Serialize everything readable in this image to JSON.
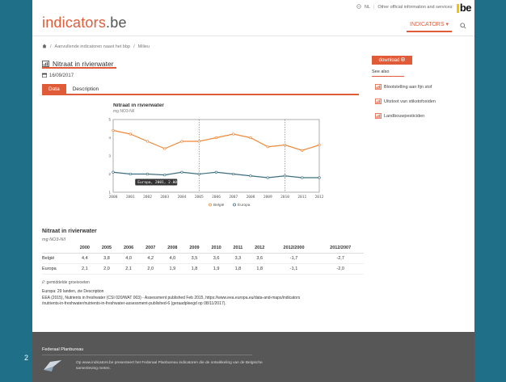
{
  "slide": {
    "number": "2"
  },
  "topbar": {
    "lang": "NL",
    "other_link": "Other official information and services:",
    "logo": "be"
  },
  "brand": {
    "name": "indicators",
    "suffix": ".be"
  },
  "nav": {
    "indicators_label": "INDICATORS",
    "search_icon": "search-icon"
  },
  "breadcrumb": {
    "home_icon": "home-icon",
    "items": [
      "Aanvullende indicatoren naast het bbp",
      "Milieu"
    ]
  },
  "page": {
    "title": "Nitraat in rivierwater",
    "date": "16/09/2017"
  },
  "tabs": [
    {
      "label": "Data",
      "active": true
    },
    {
      "label": "Description",
      "active": false
    }
  ],
  "sidebar": {
    "download_label": "download",
    "see_also_label": "See also",
    "items": [
      "Blootstelling aan fijn stof",
      "Uitstoot van stikstofoxiden",
      "Landbouwpesticiden"
    ]
  },
  "chart_data": {
    "type": "line",
    "title": "Nitraat in rivierwater",
    "subtitle": "mg NO3-N/l",
    "x": [
      2000,
      2001,
      2002,
      2003,
      2004,
      2005,
      2006,
      2007,
      2008,
      2009,
      2010,
      2011,
      2012
    ],
    "x_ticks": [
      "2000",
      "2001",
      "2002",
      "2003",
      "2004",
      "2005",
      "2006",
      "2007",
      "2008",
      "2009",
      "2010",
      "2011",
      "2012"
    ],
    "ylim": [
      1,
      5
    ],
    "y_ticks": [
      "1",
      "2",
      "3",
      "4",
      "5"
    ],
    "series": [
      {
        "name": "België",
        "color": "#f0883a",
        "values": [
          4.4,
          4.2,
          3.8,
          3.4,
          3.8,
          3.8,
          4.0,
          4.2,
          4.0,
          3.5,
          3.6,
          3.3,
          3.6
        ]
      },
      {
        "name": "Europa",
        "color": "#3d6f80",
        "values": [
          2.1,
          2.0,
          2.0,
          1.95,
          2.1,
          2.0,
          2.1,
          2.0,
          1.9,
          1.8,
          1.9,
          1.8,
          1.8
        ]
      }
    ],
    "tooltip": "Europa, 2001, 2.00",
    "vertical_markers": [
      2005,
      2010
    ]
  },
  "table": {
    "title": "Nitraat in rivierwater",
    "unit": "mg NO3-N/l",
    "headers": [
      "",
      "2000",
      "2005",
      "2006",
      "2007",
      "2008",
      "2009",
      "2010",
      "2011",
      "2012",
      "2012/2000",
      "2012/2007"
    ],
    "rows": [
      [
        "België",
        "4,4",
        "3,8",
        "4,0",
        "4,2",
        "4,0",
        "3,5",
        "3,6",
        "3,3",
        "3,6",
        "-1,7",
        "-2,7"
      ],
      [
        "Europa",
        "2,1",
        "2,0",
        "2,1",
        "2,0",
        "1,9",
        "1,8",
        "1,9",
        "1,8",
        "1,8",
        "-1,1",
        "-2,0"
      ]
    ],
    "footnote": "//: gemiddelde groeivoeten"
  },
  "sources": {
    "line1": "Europa: 29 landen, zie Description",
    "line2": "EEA (2015), Nutrients in freshwater (CSI 020/WAT 003) - Assessment published Feb 2015, https://www.eea.europa.eu/data-and-maps/indicators",
    "line3": "/nutrients-in-freshwater/nutrients-in-freshwater-assessment-published-6 (geraadpleegd op 08/11/2017)."
  },
  "footer": {
    "title": "Federaal Planbureau",
    "text": "Op www.indicators.be presenteert het Federaal Planbureau indicatoren die de ontwikkeling van de Belgische samenleving meten."
  }
}
